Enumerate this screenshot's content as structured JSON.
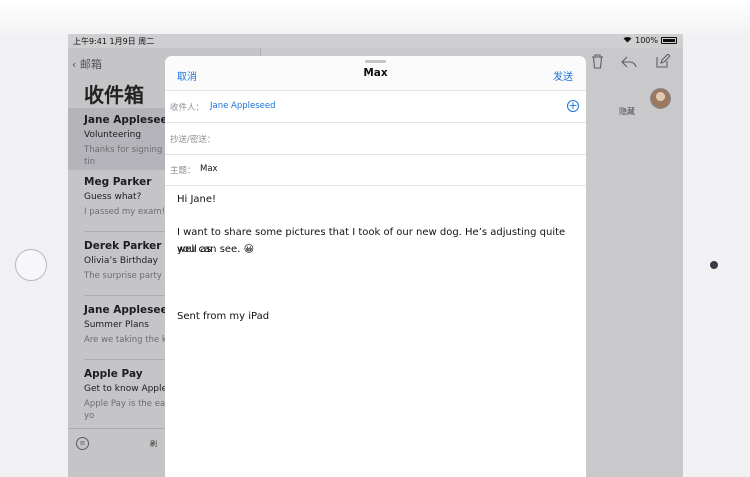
{
  "status_bar": {
    "time": "上午9:41  1月9日 周二",
    "battery": "100%"
  },
  "list": {
    "back_label": "邮箱",
    "title": "收件箱",
    "items": [
      {
        "sender": "Jane Appleseed",
        "subject": "Volunteering",
        "preview": "Thanks for signing up appreciates your tin"
      },
      {
        "sender": "Meg Parker",
        "subject": "Guess what?",
        "preview": "I passed my exam!"
      },
      {
        "sender": "Derek Parker",
        "subject": "Olivia’s Birthday",
        "preview": "The surprise party s be late!"
      },
      {
        "sender": "Jane Appleseed",
        "subject": "Summer Plans",
        "preview": "Are we taking the kic"
      },
      {
        "sender": "Apple Pay",
        "subject": "Get to know Apple F",
        "preview": "Apple Pay is the eas with the devices yo"
      }
    ],
    "footer_label": "刷"
  },
  "message": {
    "hide_label": "隐藏",
    "icons": {
      "trash": "trash-icon",
      "reply": "reply-icon",
      "compose": "compose-icon"
    }
  },
  "compose": {
    "cancel_label": "取消",
    "title": "Max",
    "send_label": "发送",
    "to_label": "收件人：",
    "to_value": "Jane Appleseed",
    "cc_label": "抄送/密送：",
    "subject_label": "主题：",
    "subject_value": "Max",
    "body": {
      "greeting": "Hi Jane!",
      "line1": "I want to share some pictures that I took of our new dog. He’s adjusting quite well as",
      "line2": "you can see. 😀",
      "signature": "Sent from my iPad"
    }
  },
  "colors": {
    "accent": "#1a73d9"
  }
}
